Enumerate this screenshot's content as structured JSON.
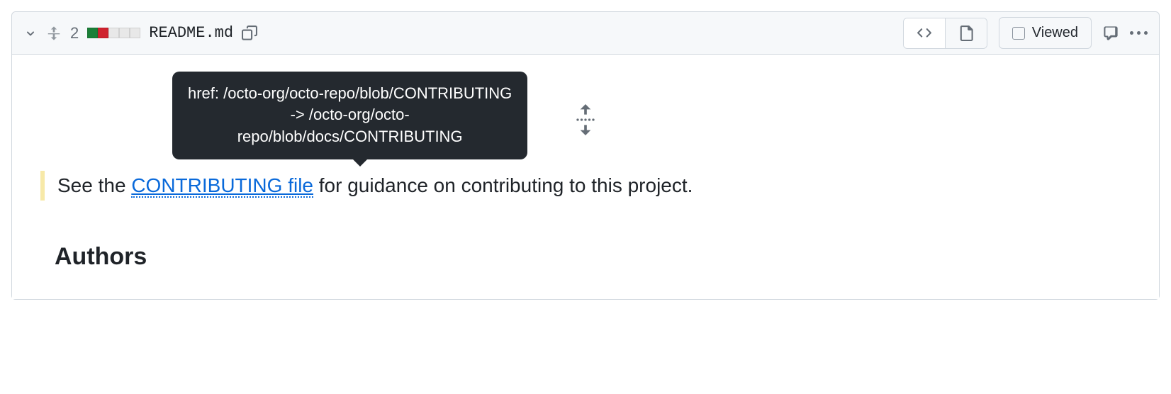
{
  "header": {
    "change_count": "2",
    "filename": "README.md",
    "viewed_label": "Viewed"
  },
  "tooltip": {
    "line1": "href: /octo-org/octo-repo/blob/CONTRIBUTING",
    "line2": "-> /octo-org/octo-",
    "line3": "repo/blob/docs/CONTRIBUTING"
  },
  "diff": {
    "prefix": "See the ",
    "link_text": "CONTRIBUTING file",
    "suffix": " for guidance on contributing to this project."
  },
  "sections": {
    "authors_heading": "Authors"
  }
}
